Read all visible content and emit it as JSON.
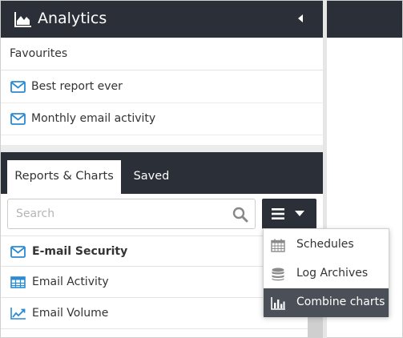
{
  "colors": {
    "header_bg": "#2b2f38",
    "accent_blue": "#2a8ad4",
    "selected_bg": "#4a4f58",
    "icon_gray": "#777777"
  },
  "header": {
    "title": "Analytics",
    "title_icon": "area-chart-icon",
    "collapse_icon": "caret-left-icon"
  },
  "favourites": {
    "title": "Favourites",
    "items": [
      {
        "label": "Best report ever",
        "icon": "envelope-icon"
      },
      {
        "label": "Monthly email activity",
        "icon": "envelope-icon"
      }
    ]
  },
  "tabs": [
    {
      "label": "Reports & Charts",
      "active": true
    },
    {
      "label": "Saved",
      "active": false
    }
  ],
  "search": {
    "placeholder": "Search",
    "value": "",
    "icon": "search-icon"
  },
  "menu_button": {
    "icons": [
      "hamburger-icon",
      "caret-down-icon"
    ]
  },
  "reports": [
    {
      "label": "E-mail Security",
      "icon": "envelope-icon",
      "bold": true
    },
    {
      "label": "Email Activity",
      "icon": "table-icon",
      "bold": false
    },
    {
      "label": "Email Volume",
      "icon": "line-chart-icon",
      "bold": false
    }
  ],
  "dropdown": {
    "items": [
      {
        "label": "Schedules",
        "icon": "calendar-icon",
        "selected": false
      },
      {
        "label": "Log Archives",
        "icon": "database-icon",
        "selected": false
      },
      {
        "label": "Combine charts",
        "icon": "bar-chart-icon",
        "selected": true
      }
    ]
  }
}
